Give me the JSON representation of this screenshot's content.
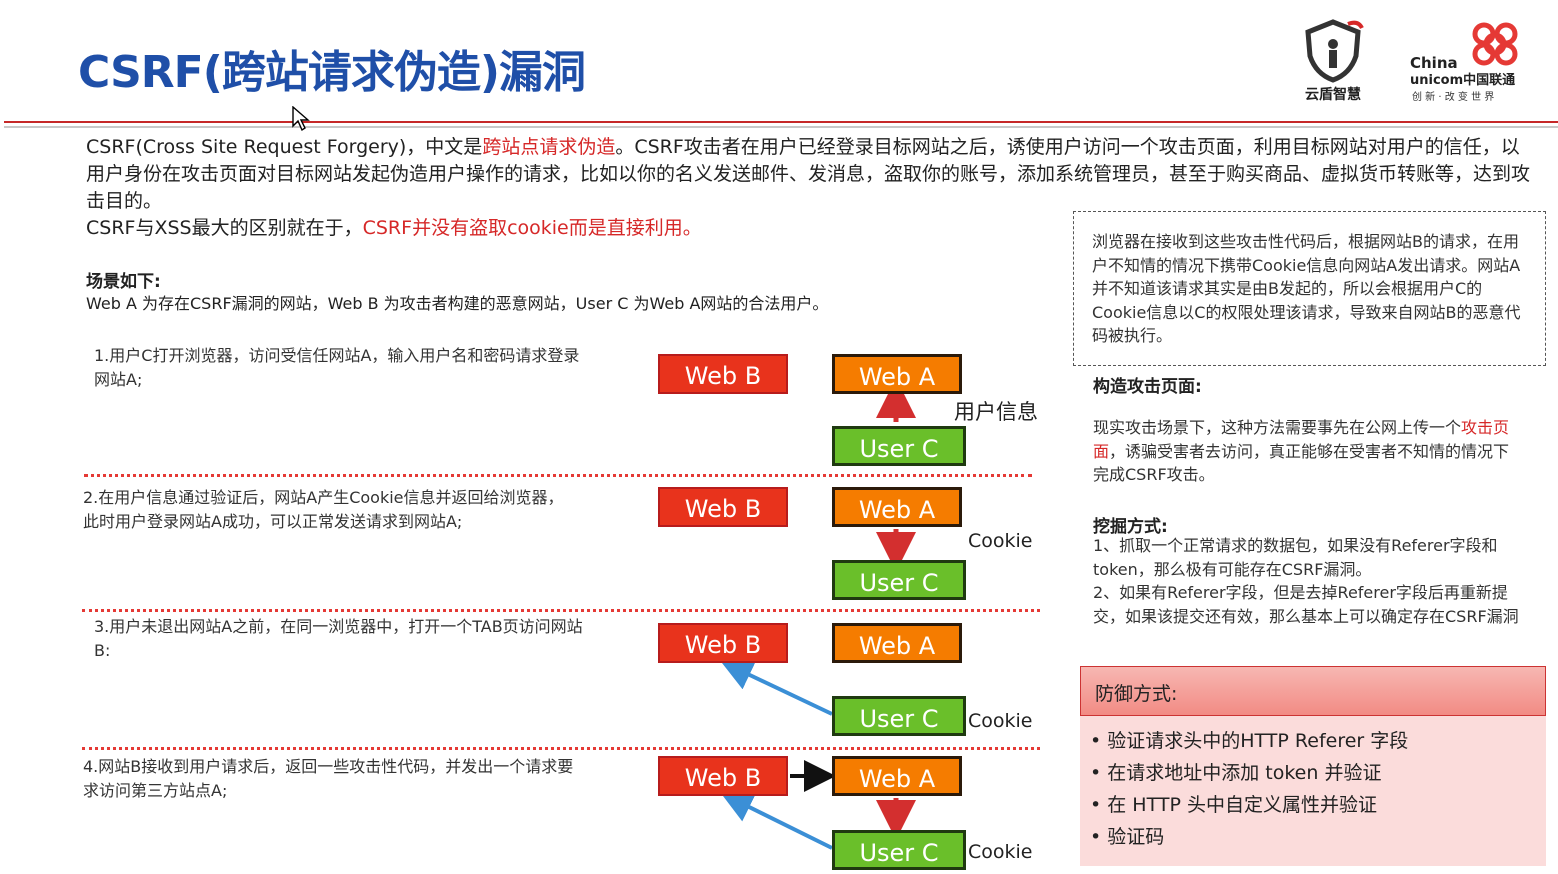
{
  "title": "CSRF(跨站请求伪造)漏洞",
  "logos": {
    "left_text": "云盾智慧",
    "right_text1": "China",
    "right_text2": "unicom中国联通",
    "right_text3": "创 新 · 改 变 世 界"
  },
  "intro": {
    "p1_a": "CSRF(Cross Site Request Forgery)，中文是",
    "p1_red": "跨站点请求伪造",
    "p1_b": "。CSRF攻击者在用户已经登录目标网站之后，诱使用户访问一个攻击页面，利用目标网站对用户的信任，以用户身份在攻击页面对目标网站发起伪造用户操作的请求，比如以你的名义发送邮件、发消息，盗取你的账号，添加系统管理员，甚至于购买商品、虚拟货币转账等，达到攻击目的。",
    "p2_a": "CSRF与XSS最大的区别就在于，",
    "p2_red": "CSRF并没有盗取cookie而是直接利用。"
  },
  "scene": {
    "heading": "场景如下:",
    "text": "Web A 为存在CSRF漏洞的网站，Web B 为攻击者构建的恶意网站，User C 为Web A网站的合法用户。"
  },
  "steps": [
    {
      "text": "1.用户C打开浏览器，访问受信任网站A，输入用户名和密码请求登录网站A;"
    },
    {
      "text": "2.在用户信息通过验证后，网站A产生Cookie信息并返回给浏览器，此时用户登录网站A成功，可以正常发送请求到网站A;"
    },
    {
      "text": "3.用户未退出网站A之前，在同一浏览器中，打开一个TAB页访问网站B:"
    },
    {
      "text": "4.网站B接收到用户请求后，返回一些攻击性代码，并发出一个请求要求访问第三方站点A;"
    }
  ],
  "boxes": {
    "web_b": "Web B",
    "web_a": "Web A",
    "user_c": "User C"
  },
  "diagram_labels": {
    "user_info": "用户信息",
    "cookie": "Cookie"
  },
  "right": {
    "box_text": "浏览器在接收到这些攻击性代码后，根据网站B的请求，在用户不知情的情况下携带Cookie信息向网站A发出请求。网站A并不知道该请求其实是由B发起的，所以会根据用户C的Cookie信息以C的权限处理该请求，导致来自网站B的恶意代码被执行。",
    "build_heading": "构造攻击页面:",
    "build_a": "现实攻击场景下，这种方法需要事先在公网上传一个",
    "build_red": "攻击页面",
    "build_b": "，诱骗受害者去访问，真正能够在受害者不知情的情况下完成CSRF攻击。",
    "mine_heading": "挖掘方式:",
    "mine_1": "1、抓取一个正常请求的数据包，如果没有Referer字段和token，那么极有可能存在CSRF漏洞。",
    "mine_2": "2、如果有Referer字段，但是去掉Referer字段后再重新提交，如果该提交还有效，那么基本上可以确定存在CSRF漏洞",
    "defense_heading": "防御方式:",
    "defense": [
      "• 验证请求头中的HTTP Referer 字段",
      "• 在请求地址中添加 token 并验证",
      "• 在 HTTP 头中自定义属性并验证",
      "• 验证码"
    ]
  },
  "colors": {
    "title": "#1f4fa8",
    "accent_red": "#d62828",
    "web_b": "#e8331c",
    "web_a": "#f57c00",
    "user_c": "#6abf2a",
    "arrow_blue": "#3b8fd6"
  }
}
